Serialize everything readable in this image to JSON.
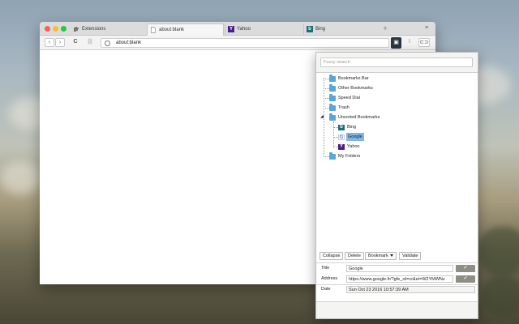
{
  "tabs": [
    {
      "title": "Extensions",
      "icon": "puzzle-icon"
    },
    {
      "title": "about:blank",
      "icon": "page-icon",
      "active": true
    },
    {
      "title": "Yahoo",
      "icon": "yahoo-icon"
    },
    {
      "title": "Bing",
      "icon": "bing-icon"
    }
  ],
  "new_tab": "+",
  "toolbar": {
    "back": "‹",
    "forward": "›",
    "reload": "C",
    "url": "about:blank"
  },
  "popup": {
    "search_placeholder": "Fuzzy search",
    "tree": [
      {
        "label": "Bookmarks Bar",
        "type": "folder"
      },
      {
        "label": "Other Bookmarks",
        "type": "folder"
      },
      {
        "label": "Speed Dial",
        "type": "folder"
      },
      {
        "label": "Trash",
        "type": "folder"
      },
      {
        "label": "Unsorted Bookmarks",
        "type": "folder",
        "expanded": true,
        "children": [
          {
            "label": "Bing",
            "icon": "bing-icon"
          },
          {
            "label": "Google",
            "icon": "google-icon",
            "selected": true
          },
          {
            "label": "Yahoo",
            "icon": "yahoo-icon"
          }
        ]
      },
      {
        "label": "My Folders",
        "type": "folder"
      }
    ],
    "buttons": {
      "collapse": "Collapse",
      "delete": "Delete",
      "bookmark": "Bookmark",
      "validate": "Validate"
    },
    "form": {
      "title_label": "Title",
      "title_value": "Google",
      "address_label": "Address",
      "address_value": "https://www.google.fr/?gfe_rd=cr&ei=W2YMWNz",
      "date_label": "Date",
      "date_value": "Sun Oct 23 2016 10:57:39 AM"
    }
  }
}
